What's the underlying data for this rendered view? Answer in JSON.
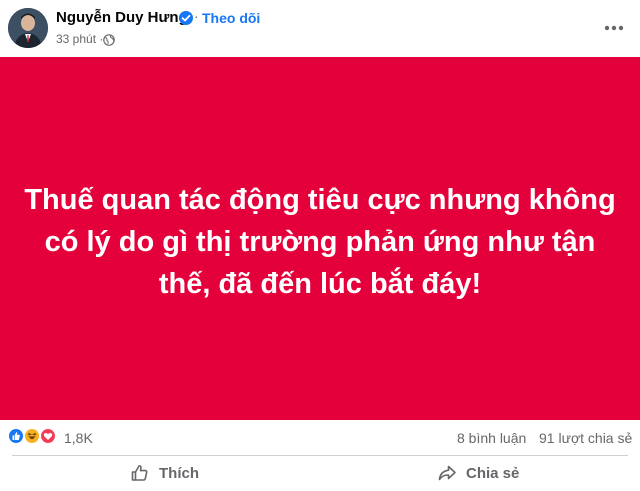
{
  "post": {
    "author": "Nguyễn Duy Hưng",
    "follow_label": "Theo dõi",
    "separator": "·",
    "timestamp": "33 phút",
    "meta_separator": "·",
    "text": "Thuế quan tác động tiêu cực nhưng không có lý do gì thị trường phản ứng như tận thế, đã đến lúc bắt đáy!",
    "card_color": "#e4003b"
  },
  "stats": {
    "reaction_count": "1,8K",
    "reactions": [
      "like-icon",
      "haha-icon",
      "love-icon"
    ],
    "comments": "8 bình luận",
    "shares": "91 lượt chia sẻ"
  },
  "actions": {
    "like_label": "Thích",
    "share_label": "Chia sẻ"
  },
  "colors": {
    "accent": "#1877f2",
    "muted": "#65676b",
    "love": "#f33e58",
    "haha": "#f7b125"
  }
}
